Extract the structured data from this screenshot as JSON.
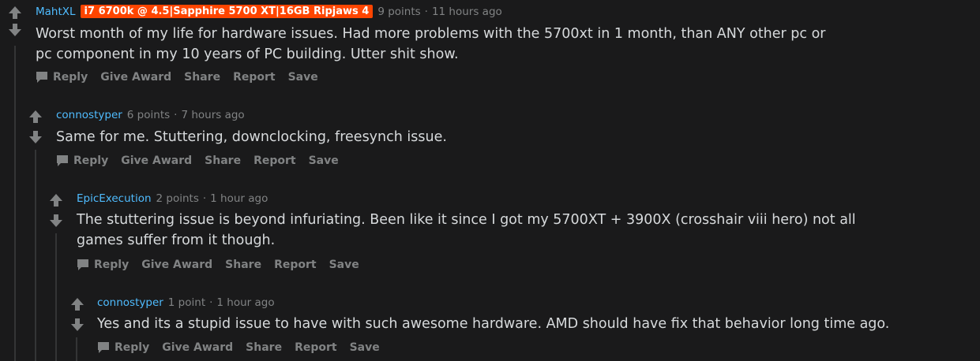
{
  "comments": [
    {
      "author": "MahtXL",
      "flair": "i7 6700k @ 4.5|Sapphire 5700 XT|16GB Ripjaws 4",
      "points": "9 points",
      "sep": "·",
      "time": "11 hours ago",
      "body": "Worst month of my life for hardware issues. Had more problems with the 5700xt in 1 month, than ANY other pc or pc component in my 10 years of PC building. Utter shit show."
    },
    {
      "author": "connostyper",
      "points": "6 points",
      "sep": "·",
      "time": "7 hours ago",
      "body": "Same for me. Stuttering, downclocking, freesynch issue."
    },
    {
      "author": "EpicExecution",
      "points": "2 points",
      "sep": "·",
      "time": "1 hour ago",
      "body": "The stuttering issue is beyond infuriating. Been like it since I got my 5700XT + 3900X (crosshair viii hero) not all games suffer from it though."
    },
    {
      "author": "connostyper",
      "points": "1 point",
      "sep": "·",
      "time": "1 hour ago",
      "body": "Yes and its a stupid issue to have with such awesome hardware. AMD should have fix that behavior long time ago."
    }
  ],
  "actions": {
    "reply": "Reply",
    "give_award": "Give Award",
    "share": "Share",
    "report": "Report",
    "save": "Save"
  },
  "icons": {
    "upvote": "upvote-arrow-icon",
    "downvote": "downvote-arrow-icon",
    "reply": "speech-bubble-icon"
  },
  "colors": {
    "background": "#1a1a1b",
    "author": "#4fbcff",
    "flair_bg": "#ff4500",
    "muted": "#818384",
    "text": "#d7dadc"
  }
}
